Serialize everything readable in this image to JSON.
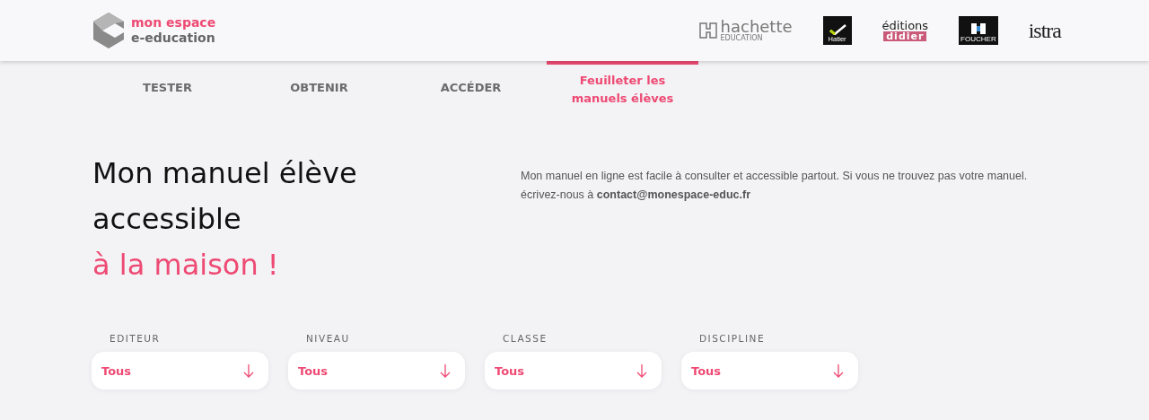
{
  "brand": {
    "line1": "mon espace",
    "line2": "e-education"
  },
  "publishers": [
    {
      "kind": "hachette",
      "name": "hachette",
      "sub": "EDUCATION"
    },
    {
      "kind": "hatier",
      "name": "Hatier"
    },
    {
      "kind": "didier",
      "name": "éditions",
      "sub": "didier"
    },
    {
      "kind": "foucher",
      "name": "FOUCHER"
    },
    {
      "kind": "istra",
      "name": "istra"
    }
  ],
  "tabs": [
    {
      "label": "TESTER",
      "selected": false
    },
    {
      "label": "OBTENIR",
      "selected": false
    },
    {
      "label": "ACCÉDER",
      "selected": false
    },
    {
      "label": "Feuilleter les manuels élèves",
      "selected": true
    }
  ],
  "heading": {
    "line1": "Mon manuel élève",
    "line2": "accessible",
    "highlight": "à la maison !"
  },
  "description": "Mon manuel en ligne est facile à consulter et accessible partout. Si vous ne trouvez pas votre manuel. écrivez-nous à **contact@monespace-educ.fr**",
  "filters": [
    {
      "label": "EDITEUR",
      "value": "Tous"
    },
    {
      "label": "NIVEAU",
      "value": "Tous"
    },
    {
      "label": "CLASSE",
      "value": "Tous"
    },
    {
      "label": "DISCIPLINE",
      "value": "Tous"
    }
  ]
}
